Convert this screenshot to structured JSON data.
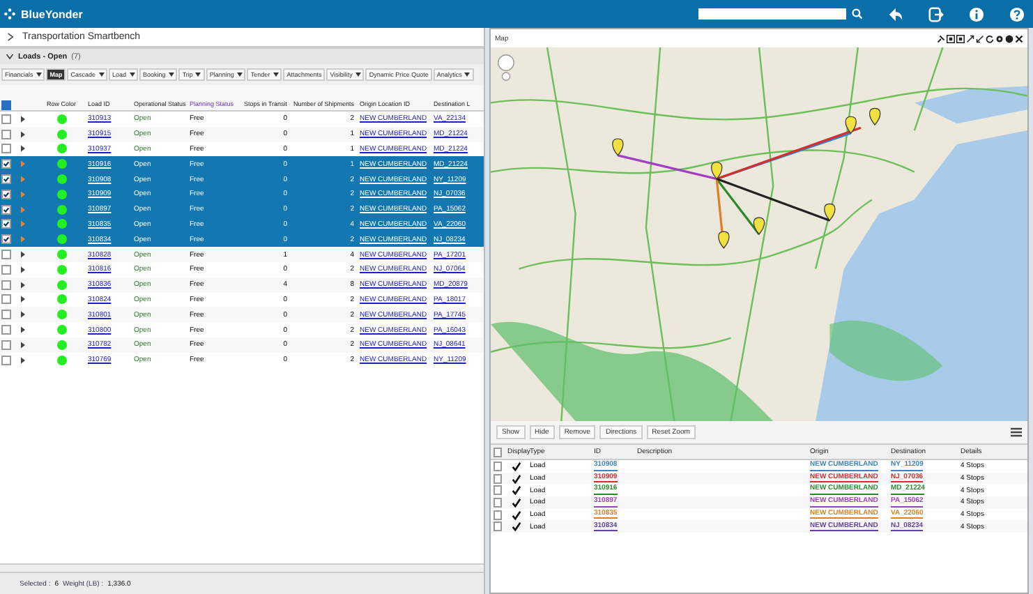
{
  "app_bar": {
    "brand": "BlueYonder"
  },
  "left": {
    "title": "Transportation Smartbench",
    "section": {
      "title": "Loads - Open",
      "count": "(7)",
      "expanded": true
    },
    "tabs": [
      {
        "label": "Financials",
        "dropdown": true,
        "selected": false
      },
      {
        "label": "Map",
        "dropdown": false,
        "selected": true
      },
      {
        "label": "Cascade",
        "dropdown": true,
        "selected": false
      },
      {
        "label": "Load",
        "dropdown": true,
        "selected": false
      },
      {
        "label": "Booking",
        "dropdown": true,
        "selected": false
      },
      {
        "label": "Trip",
        "dropdown": true,
        "selected": false
      },
      {
        "label": "Planning",
        "dropdown": true,
        "selected": false
      },
      {
        "label": "Tender",
        "dropdown": true,
        "selected": false
      },
      {
        "label": "Attachments",
        "dropdown": false,
        "selected": false
      },
      {
        "label": "Visibility",
        "dropdown": true,
        "selected": false
      },
      {
        "label": "Dynamic Price Quote",
        "dropdown": false,
        "selected": false
      },
      {
        "label": "Analytics",
        "dropdown": true,
        "selected": false
      }
    ],
    "select_all_checked": true,
    "columns": [
      "Row Color",
      "Load ID",
      "Operational Status",
      "Planning Status",
      "Stops in Transit",
      "Number of Shipments",
      "Origin Location ID",
      "Destination L"
    ],
    "rows": [
      {
        "id": "310913",
        "op": "Open",
        "plan": "Free",
        "stops": "0",
        "shipments": "2",
        "origin": "NEW CUMBERLAND",
        "dest": "VA_22134",
        "selected": false,
        "color": "#22ee22"
      },
      {
        "id": "310915",
        "op": "Open",
        "plan": "Free",
        "stops": "0",
        "shipments": "1",
        "origin": "NEW CUMBERLAND",
        "dest": "MD_21224",
        "selected": false,
        "color": "#22ee22"
      },
      {
        "id": "310937",
        "op": "Open",
        "plan": "Free",
        "stops": "0",
        "shipments": "1",
        "origin": "NEW CUMBERLAND",
        "dest": "MD_21224",
        "selected": false,
        "color": "#22ee22"
      },
      {
        "id": "310916",
        "op": "Open",
        "plan": "Free",
        "stops": "0",
        "shipments": "1",
        "origin": "NEW CUMBERLAND",
        "dest": "MD_21224",
        "selected": true,
        "color": "#22ee22"
      },
      {
        "id": "310908",
        "op": "Open",
        "plan": "Free",
        "stops": "0",
        "shipments": "2",
        "origin": "NEW CUMBERLAND",
        "dest": "NY_11209",
        "selected": true,
        "color": "#22ee22"
      },
      {
        "id": "310909",
        "op": "Open",
        "plan": "Free",
        "stops": "0",
        "shipments": "2",
        "origin": "NEW CUMBERLAND",
        "dest": "NJ_07036",
        "selected": true,
        "color": "#22ee22"
      },
      {
        "id": "310897",
        "op": "Open",
        "plan": "Free",
        "stops": "0",
        "shipments": "2",
        "origin": "NEW CUMBERLAND",
        "dest": "PA_15062",
        "selected": true,
        "color": "#22ee22"
      },
      {
        "id": "310835",
        "op": "Open",
        "plan": "Free",
        "stops": "0",
        "shipments": "4",
        "origin": "NEW CUMBERLAND",
        "dest": "VA_22060",
        "selected": true,
        "color": "#22ee22"
      },
      {
        "id": "310834",
        "op": "Open",
        "plan": "Free",
        "stops": "0",
        "shipments": "2",
        "origin": "NEW CUMBERLAND",
        "dest": "NJ_08234",
        "selected": true,
        "color": "#22ee22"
      },
      {
        "id": "310828",
        "op": "Open",
        "plan": "Free",
        "stops": "1",
        "shipments": "4",
        "origin": "NEW CUMBERLAND",
        "dest": "PA_17201",
        "selected": false,
        "color": "#22ee22"
      },
      {
        "id": "310816",
        "op": "Open",
        "plan": "Free",
        "stops": "0",
        "shipments": "2",
        "origin": "NEW CUMBERLAND",
        "dest": "NJ_07064",
        "selected": false,
        "color": "#22ee22"
      },
      {
        "id": "310836",
        "op": "Open",
        "plan": "Free",
        "stops": "4",
        "shipments": "8",
        "origin": "NEW CUMBERLAND",
        "dest": "MD_20879",
        "selected": false,
        "color": "#22ee22"
      },
      {
        "id": "310824",
        "op": "Open",
        "plan": "Free",
        "stops": "0",
        "shipments": "2",
        "origin": "NEW CUMBERLAND",
        "dest": "PA_18017",
        "selected": false,
        "color": "#22ee22"
      },
      {
        "id": "310801",
        "op": "Open",
        "plan": "Free",
        "stops": "0",
        "shipments": "2",
        "origin": "NEW CUMBERLAND",
        "dest": "PA_17745",
        "selected": false,
        "color": "#22ee22"
      },
      {
        "id": "310800",
        "op": "Open",
        "plan": "Free",
        "stops": "0",
        "shipments": "2",
        "origin": "NEW CUMBERLAND",
        "dest": "PA_16043",
        "selected": false,
        "color": "#22ee22"
      },
      {
        "id": "310782",
        "op": "Open",
        "plan": "Free",
        "stops": "0",
        "shipments": "2",
        "origin": "NEW CUMBERLAND",
        "dest": "NJ_08641",
        "selected": false,
        "color": "#22ee22"
      },
      {
        "id": "310769",
        "op": "Open",
        "plan": "Free",
        "stops": "0",
        "shipments": "2",
        "origin": "NEW CUMBERLAND",
        "dest": "NY_11209",
        "selected": false,
        "color": "#22ee22"
      }
    ],
    "status": {
      "selected_label": "Selected :",
      "selected_value": "6",
      "weight_label": "Weight (LB) :",
      "weight_value": "1,336.0"
    }
  },
  "map": {
    "title": "Map",
    "buttons": [
      "Show",
      "Hide",
      "Remove",
      "Directions",
      "Reset Zoom"
    ],
    "select_all_checked": false,
    "columns": [
      "Display",
      "Type",
      "ID",
      "Description",
      "Origin",
      "Destination",
      "Details"
    ],
    "rows": [
      {
        "checked": false,
        "display": true,
        "type": "Load",
        "id": "310908",
        "origin": "NEW CUMBERLAND",
        "dest": "NY_11209",
        "details": "4 Stops",
        "color": "#3a82c4"
      },
      {
        "checked": false,
        "display": true,
        "type": "Load",
        "id": "310909",
        "origin": "NEW CUMBERLAND",
        "dest": "NJ_07036",
        "details": "4 Stops",
        "color": "#d03030"
      },
      {
        "checked": false,
        "display": true,
        "type": "Load",
        "id": "310916",
        "origin": "NEW CUMBERLAND",
        "dest": "MD_21224",
        "details": "4 Stops",
        "color": "#2a8a2a"
      },
      {
        "checked": false,
        "display": true,
        "type": "Load",
        "id": "310897",
        "origin": "NEW CUMBERLAND",
        "dest": "PA_15062",
        "details": "4 Stops",
        "color": "#a040c0"
      },
      {
        "checked": false,
        "display": true,
        "type": "Load",
        "id": "310835",
        "origin": "NEW CUMBERLAND",
        "dest": "VA_22060",
        "details": "4 Stops",
        "color": "#e08020"
      },
      {
        "checked": false,
        "display": true,
        "type": "Load",
        "id": "310834",
        "origin": "NEW CUMBERLAND",
        "dest": "NJ_08234",
        "details": "4 Stops",
        "color": "#6040a0"
      }
    ]
  }
}
